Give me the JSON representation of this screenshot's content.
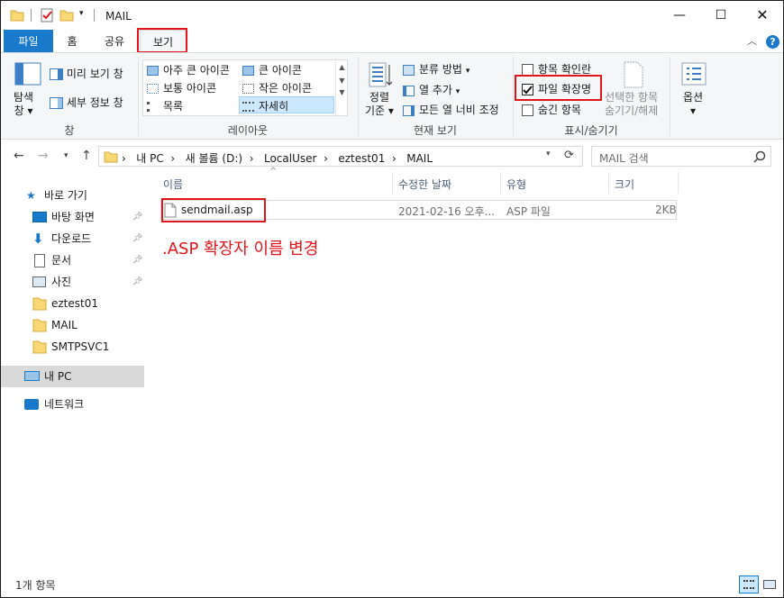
{
  "window": {
    "title": "MAIL"
  },
  "tabs": {
    "file": "파일",
    "home": "홈",
    "share": "공유",
    "view": "보기"
  },
  "ribbon": {
    "pane": {
      "nav_pane": "탐색\n창",
      "preview": "미리 보기 창",
      "details": "세부 정보 창",
      "group": "창"
    },
    "layout": {
      "items": [
        "아주 큰 아이콘",
        "큰 아이콘",
        "보통 아이콘",
        "작은 아이콘",
        "목록",
        "자세히"
      ],
      "group": "레이아웃"
    },
    "current_view": {
      "sort_line1": "정렬",
      "sort_line2": "기준",
      "group_by": "분류 방법",
      "add_columns": "열 추가",
      "fit_columns": "모든 열 너비 조정",
      "group": "현재 보기"
    },
    "show_hide": {
      "item_checkboxes": "항목 확인란",
      "file_extensions": "파일 확장명",
      "hidden_items": "숨긴 항목",
      "hide_selected_line1": "선택한 항목",
      "hide_selected_line2": "숨기기/해제",
      "group": "표시/숨기기"
    },
    "options": {
      "label": "옵션"
    }
  },
  "address": {
    "crumbs": [
      "내 PC",
      "새 볼륨 (D:)",
      "LocalUser",
      "eztest01",
      "MAIL"
    ],
    "search_placeholder": "MAIL 검색"
  },
  "sidebar": {
    "quick_access": "바로 가기",
    "items": [
      "바탕 화면",
      "다운로드",
      "문서",
      "사진",
      "eztest01",
      "MAIL",
      "SMTPSVC1"
    ],
    "this_pc": "내 PC",
    "network": "네트워크"
  },
  "columns": {
    "name": "이름",
    "modified": "수정한 날짜",
    "type": "유형",
    "size": "크기"
  },
  "files": [
    {
      "name": "sendmail.asp",
      "modified": "2021-02-16 오후...",
      "type": "ASP 파일",
      "size": "2KB"
    }
  ],
  "annotation": ".ASP 확장자 이름 변경",
  "status": {
    "count": "1개 항목"
  },
  "colors": {
    "accent": "#1979ca",
    "highlight": "#e0151b",
    "selection": "#cce8ff"
  }
}
